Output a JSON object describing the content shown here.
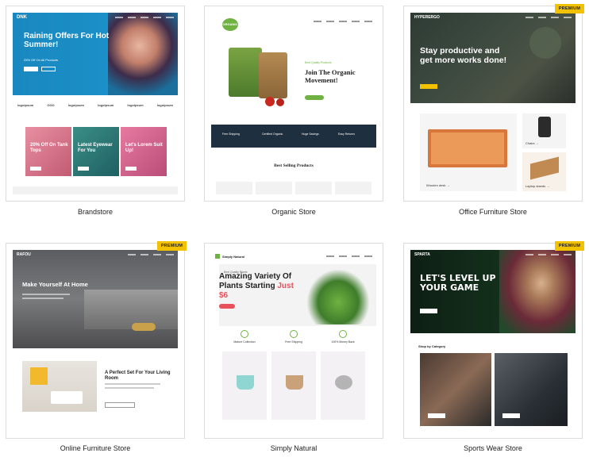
{
  "cards": [
    {
      "caption": "Brandstore",
      "premium": ""
    },
    {
      "caption": "Organic Store",
      "premium": ""
    },
    {
      "caption": "Office Furniture Store",
      "premium": "PREMIUM"
    },
    {
      "caption": "Online Furniture Store",
      "premium": "PREMIUM"
    },
    {
      "caption": "Simply Natural",
      "premium": ""
    },
    {
      "caption": "Sports Wear Store",
      "premium": "PREMIUM"
    }
  ],
  "brandstore": {
    "logo": "DNK",
    "hero_title": "Raining Offers For Hot Summer!",
    "hero_sub": "25% Off On All Products",
    "logos": [
      "logoipsum",
      "OOO",
      "logoipsum",
      "logoipsum",
      "logoipsum",
      "logoipsum"
    ],
    "tiles": [
      "20% Off On Tank Tops",
      "Latest Eyewear For You",
      "Let's Lorem Suit Up!"
    ]
  },
  "organic": {
    "logo": "ORGANIC",
    "tag": "Best Quality Products",
    "hero_title": "Join The Organic Movement!",
    "band": [
      "Free Shipping",
      "Certified Organic",
      "Huge Savings",
      "Easy Returns"
    ],
    "best_selling": "Best Selling Products"
  },
  "office": {
    "logo": "HYPERERGO",
    "hero_title": "Stay productive and get more works done!",
    "labels": [
      "Wooden desk →",
      "Chairs →",
      "Laptop stands →"
    ]
  },
  "online_furniture": {
    "logo": "RAFOU",
    "hero_title": "Make Yourself At Home",
    "section_title": "A Perfect Set For Your Living Room"
  },
  "simply_natural": {
    "logo": "Simply Natural",
    "tag": "Best Quality Plants",
    "title_a": "Amazing Variety Of Plants Starting ",
    "title_b": "Just $6",
    "features": [
      "Mature Collection",
      "Free Shipping",
      "100% Money Back"
    ]
  },
  "sports": {
    "logo": "SPARTA",
    "hero_title": "LET'S LEVEL UP YOUR GAME",
    "category": "Shop by Category"
  },
  "colors": {
    "premium": "#f2c100",
    "brand_blue": "#1b8fc8",
    "organic_green": "#6fb241",
    "coral": "#e8505b"
  }
}
